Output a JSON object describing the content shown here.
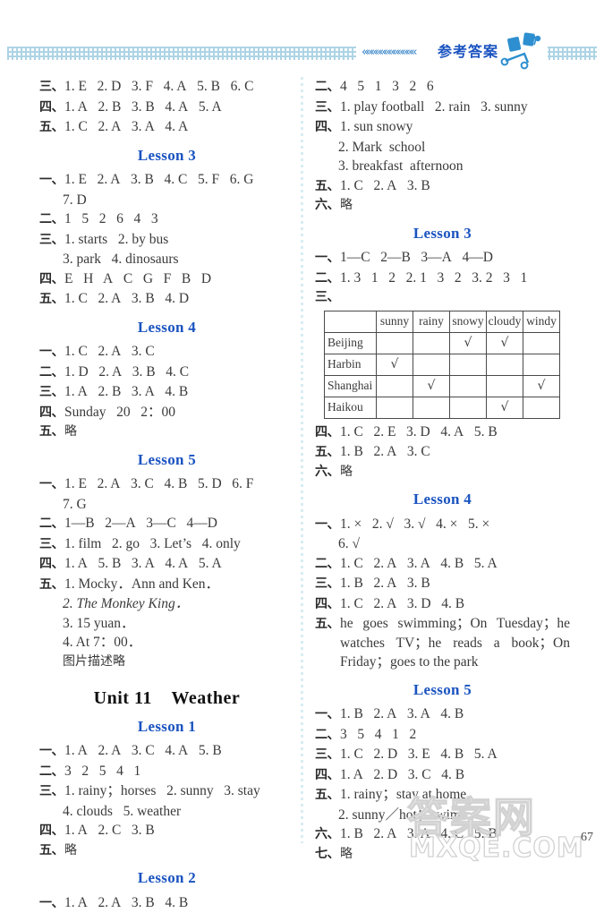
{
  "header": {
    "chevrons": "««««««««««««",
    "title_cn": "参考答案",
    "accent_color": "#1a53c0",
    "band_color": "#8fc4dc"
  },
  "page_number": "67",
  "watermark": {
    "cn": "答案网",
    "en": "MXQE.COM"
  },
  "left_column": {
    "blocks": [
      {
        "type": "answer",
        "label": "三、",
        "text": "1. E   2. D   3. F   4. A   5. B   6. C"
      },
      {
        "type": "answer",
        "label": "四、",
        "text": "1. A   2. B   3. B   4. A   5. A"
      },
      {
        "type": "answer",
        "label": "五、",
        "text": "1. C   2. A   3. A   4. A"
      },
      {
        "type": "lesson",
        "text": "Lesson 3"
      },
      {
        "type": "answer",
        "label": "一、",
        "text": "1. E   2. A   3. B   4. C   5. F   6. G"
      },
      {
        "type": "cont",
        "text": "7. D"
      },
      {
        "type": "answer",
        "label": "二、",
        "text": "1   5   2   6   4   3"
      },
      {
        "type": "answer",
        "label": "三、",
        "text": "1. starts   2. by bus"
      },
      {
        "type": "cont",
        "text": "3. park   4. dinosaurs"
      },
      {
        "type": "answer",
        "label": "四、",
        "text": "E   H   A   C   G   F   B   D"
      },
      {
        "type": "answer",
        "label": "五、",
        "text": "1. C   2. A   3. B   4. D"
      },
      {
        "type": "lesson",
        "text": "Lesson 4"
      },
      {
        "type": "answer",
        "label": "一、",
        "text": "1. C   2. A   3. C"
      },
      {
        "type": "answer",
        "label": "二、",
        "text": "1. D   2. A   3. B   4. C"
      },
      {
        "type": "answer",
        "label": "三、",
        "text": "1. A   2. B   3. A   4. B"
      },
      {
        "type": "answer",
        "label": "四、",
        "text": "Sunday   20   2：00"
      },
      {
        "type": "answer",
        "label": "五、",
        "text": "略",
        "cn": true
      },
      {
        "type": "lesson",
        "text": "Lesson 5"
      },
      {
        "type": "answer",
        "label": "一、",
        "text": "1. E   2. A   3. C   4. B   5. D   6. F"
      },
      {
        "type": "cont",
        "text": "7. G"
      },
      {
        "type": "answer",
        "label": "二、",
        "text": "1—B   2—A   3—C   4—D"
      },
      {
        "type": "answer",
        "label": "三、",
        "text": "1. film   2. go   3. Let’s   4. only"
      },
      {
        "type": "answer",
        "label": "四、",
        "text": "1. A   5. B   3. A   4. A   5. A"
      },
      {
        "type": "answer",
        "label": "五、",
        "text": "1. Mocky．Ann and Ken．"
      },
      {
        "type": "cont-italic",
        "text": "2. The Monkey King．"
      },
      {
        "type": "cont",
        "text": "3. 15 yuan．"
      },
      {
        "type": "cont",
        "text": "4. At 7：00．"
      },
      {
        "type": "cont-cn",
        "text": "图片描述略"
      },
      {
        "type": "unit",
        "text": "Unit 11    Weather"
      },
      {
        "type": "lesson",
        "text": "Lesson 1"
      },
      {
        "type": "answer",
        "label": "一、",
        "text": "1. A   2. A   3. C   4. A   5. B"
      },
      {
        "type": "answer",
        "label": "二、",
        "text": "3   2   5   4   1"
      },
      {
        "type": "answer",
        "label": "三、",
        "text": "1. rainy；horses   2. sunny   3. stay"
      },
      {
        "type": "cont",
        "text": "4. clouds   5. weather"
      },
      {
        "type": "answer",
        "label": "四、",
        "text": "1. A   2. C   3. B"
      },
      {
        "type": "answer",
        "label": "五、",
        "text": "略",
        "cn": true
      },
      {
        "type": "lesson",
        "text": "Lesson 2"
      },
      {
        "type": "answer",
        "label": "一、",
        "text": "1. A   2. A   3. B   4. B"
      }
    ]
  },
  "right_column": {
    "blocks_top": [
      {
        "type": "answer",
        "label": "二、",
        "text": "4   5   1   3   2   6"
      },
      {
        "type": "answer",
        "label": "三、",
        "text": "1. play football   2. rain   3. sunny"
      },
      {
        "type": "answer",
        "label": "四、",
        "text": "1. sun snowy"
      },
      {
        "type": "cont",
        "text": "2. Mark  school"
      },
      {
        "type": "cont",
        "text": "3. breakfast  afternoon"
      },
      {
        "type": "answer",
        "label": "五、",
        "text": "1. C   2. A   3. B"
      },
      {
        "type": "answer",
        "label": "六、",
        "text": "略",
        "cn": true
      },
      {
        "type": "lesson",
        "text": "Lesson 3"
      },
      {
        "type": "answer",
        "label": "一、",
        "text": "1—C   2—B   3—A   4—D"
      },
      {
        "type": "answer",
        "label": "二、",
        "text": "1. 3   1   2   2. 1   3   2   3. 2   3   1"
      },
      {
        "type": "answer",
        "label": "三、",
        "text": ""
      }
    ],
    "blocks_bottom": [
      {
        "type": "answer",
        "label": "四、",
        "text": "1. C   2. E   3. D   4. A   5. B"
      },
      {
        "type": "answer",
        "label": "五、",
        "text": "1. B   2. A   3. C"
      },
      {
        "type": "answer",
        "label": "六、",
        "text": "略",
        "cn": true
      },
      {
        "type": "lesson",
        "text": "Lesson 4"
      },
      {
        "type": "answer",
        "label": "一、",
        "text": "1. ×   2. √   3. √   4. ×   5. ×"
      },
      {
        "type": "cont",
        "text": "6. √"
      },
      {
        "type": "answer",
        "label": "二、",
        "text": "1. C   2. A   3. A   4. B   5. A"
      },
      {
        "type": "answer",
        "label": "三、",
        "text": "1. B   2. A   3. B"
      },
      {
        "type": "answer",
        "label": "四、",
        "text": "1. C   2. A   3. D   4. B"
      },
      {
        "type": "answer-wrap",
        "label": "五、",
        "text": "he goes swimming；On Tuesday；he watches TV；he reads a book；On Friday；goes to the park"
      },
      {
        "type": "lesson",
        "text": "Lesson 5"
      },
      {
        "type": "answer",
        "label": "一、",
        "text": "1. B   2. A   3. A   4. B"
      },
      {
        "type": "answer",
        "label": "二、",
        "text": "3   5   4   1   2"
      },
      {
        "type": "answer",
        "label": "三、",
        "text": "1. C   2. D   3. E   4. B   5. A"
      },
      {
        "type": "answer",
        "label": "四、",
        "text": "1. A   2. D   3. C   4. B"
      },
      {
        "type": "answer",
        "label": "五、",
        "text": "1. rainy；stay at home"
      },
      {
        "type": "cont",
        "text": "2. sunny／hot；swim"
      },
      {
        "type": "answer",
        "label": "六、",
        "text": "1. B   2. A   3. A   4. C   5. B"
      },
      {
        "type": "answer",
        "label": "七、",
        "text": "略",
        "cn": true
      }
    ],
    "weather_table": {
      "columns": [
        "",
        "sunny",
        "rainy",
        "snowy",
        "cloudy",
        "windy"
      ],
      "rows": [
        {
          "city": "Beijing",
          "marks": [
            "",
            "",
            "√",
            "√",
            ""
          ]
        },
        {
          "city": "Harbin",
          "marks": [
            "√",
            "",
            "",
            "",
            ""
          ]
        },
        {
          "city": "Shanghai",
          "marks": [
            "",
            "√",
            "",
            "",
            "√"
          ]
        },
        {
          "city": "Haikou",
          "marks": [
            "",
            "",
            "",
            "√",
            ""
          ]
        }
      ]
    }
  }
}
